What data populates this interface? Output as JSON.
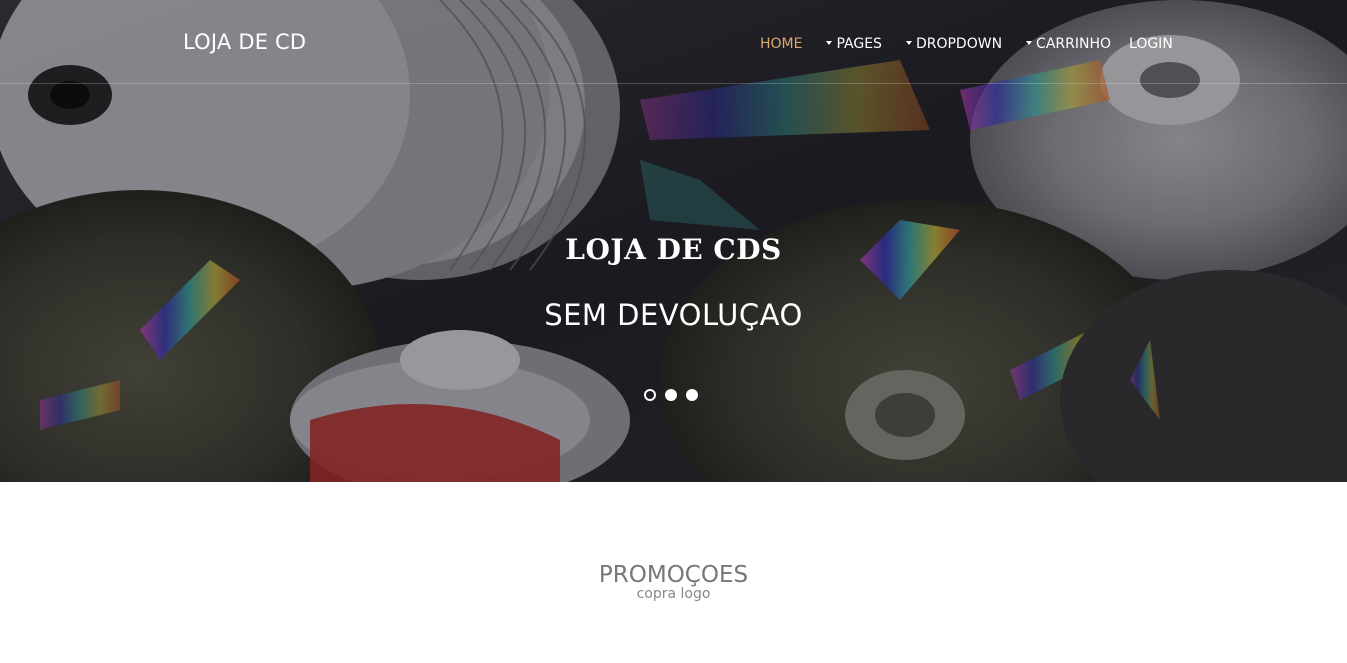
{
  "brand": {
    "name": "LOJA DE CD"
  },
  "nav": {
    "items": [
      {
        "label": "HOME",
        "active": true,
        "dropdown": false
      },
      {
        "label": "PAGES",
        "active": false,
        "dropdown": true
      },
      {
        "label": "DROPDOWN",
        "active": false,
        "dropdown": true
      },
      {
        "label": "CARRINHO",
        "active": false,
        "dropdown": true
      },
      {
        "label": "LOGIN",
        "active": false,
        "dropdown": false
      }
    ]
  },
  "hero": {
    "title": "LOJA DE CDS",
    "subtitle": "SEM DEVOLUÇAO",
    "slide_count": 3,
    "active_slide": 1,
    "background_icon": "cd-discs-photo"
  },
  "promo": {
    "title": "PROMOÇOES",
    "subtitle": "copra logo"
  },
  "colors": {
    "accent": "#d9a86a",
    "nav_text": "#ffffff",
    "promo_text": "#777777"
  }
}
